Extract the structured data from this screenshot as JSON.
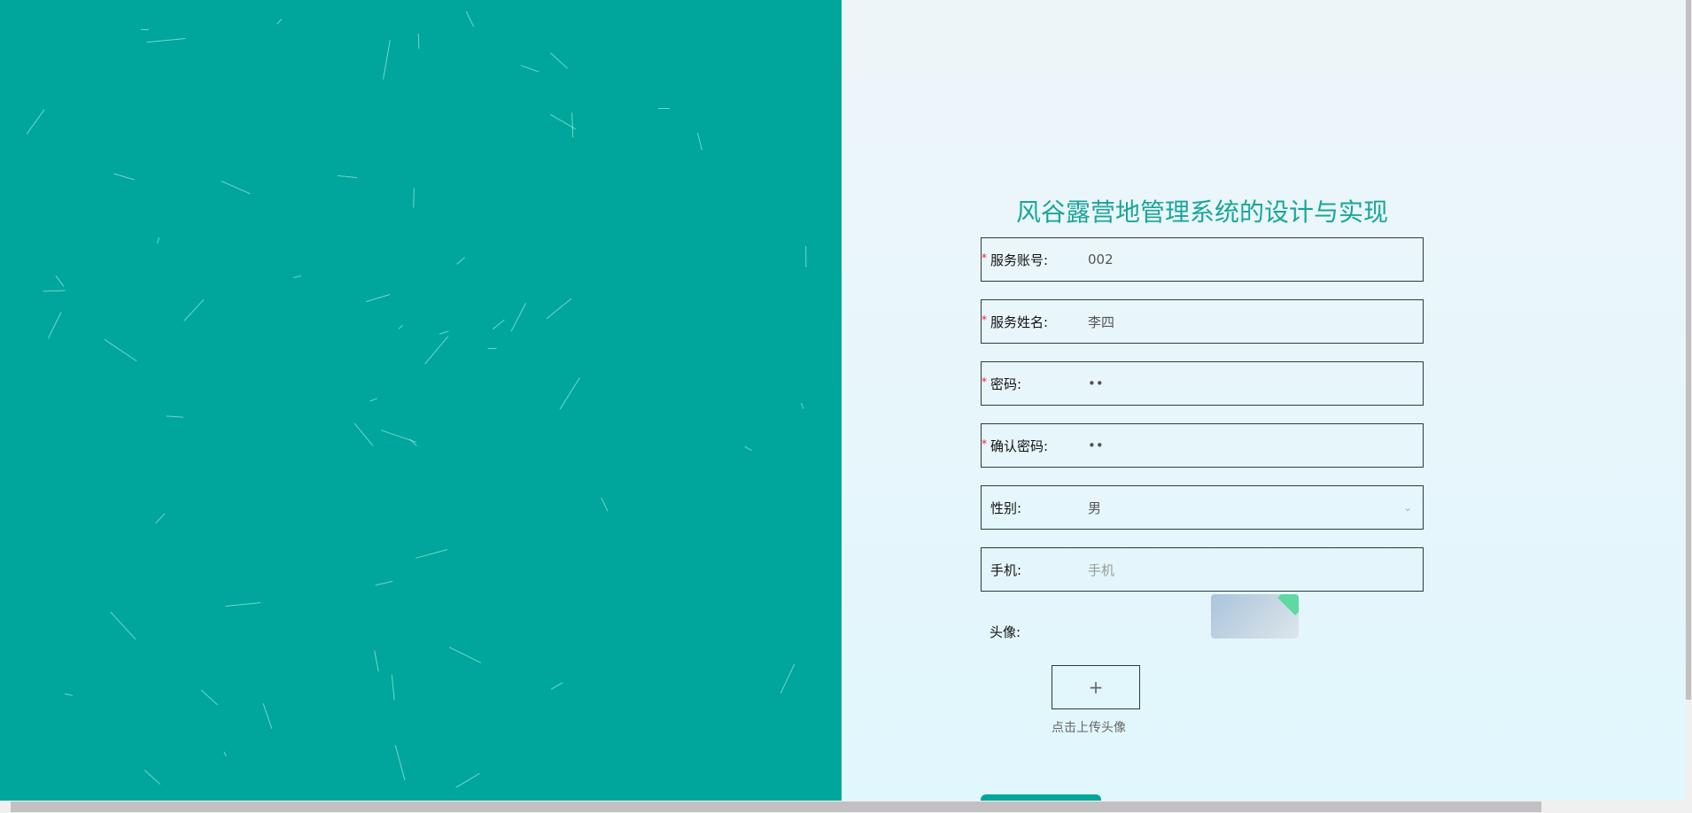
{
  "title": "风谷露营地管理系统的设计与实现",
  "fields": [
    {
      "label": "服务账号:",
      "value": "002",
      "required": true
    },
    {
      "label": "服务姓名:",
      "value": "李四",
      "required": true
    },
    {
      "label": "密码:",
      "value": "••",
      "required": true
    },
    {
      "label": "确认密码:",
      "value": "••",
      "required": true
    },
    {
      "label": "性别:",
      "value": "男",
      "required": false
    },
    {
      "label": "手机:",
      "placeholder": "手机",
      "required": false
    }
  ],
  "required_mark": "*",
  "avatar": {
    "label": "头像:",
    "upload_icon": "+",
    "upload_caption": "点击上传头像"
  },
  "colors": {
    "accent": "#00a69b",
    "title": "#1aa59a"
  }
}
